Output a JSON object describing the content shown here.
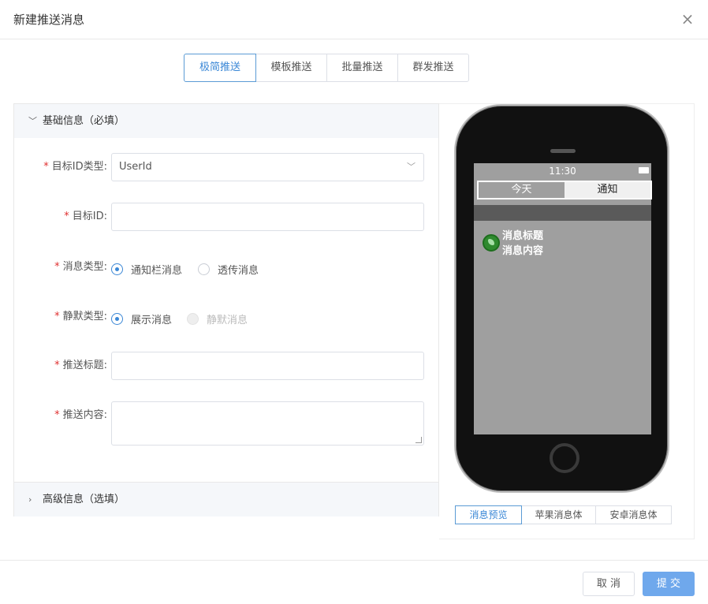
{
  "dialog": {
    "title": "新建推送消息",
    "close_icon": "×"
  },
  "tabs": [
    {
      "label": "极简推送",
      "active": true
    },
    {
      "label": "模板推送",
      "active": false
    },
    {
      "label": "批量推送",
      "active": false
    },
    {
      "label": "群发推送",
      "active": false
    }
  ],
  "form": {
    "basic_section": "基础信息（必填）",
    "advanced_section": "高级信息（选填）",
    "target_type": {
      "label": "目标ID类型:",
      "value": "UserId"
    },
    "target_id": {
      "label": "目标ID:",
      "value": ""
    },
    "message_type": {
      "label": "消息类型:",
      "options": [
        {
          "label": "通知栏消息",
          "selected": true
        },
        {
          "label": "透传消息",
          "selected": false
        }
      ]
    },
    "silent_type": {
      "label": "静默类型:",
      "options": [
        {
          "label": "展示消息",
          "selected": true
        },
        {
          "label": "静默消息",
          "selected": false,
          "disabled": true
        }
      ]
    },
    "push_title": {
      "label": "推送标题:",
      "value": ""
    },
    "push_content": {
      "label": "推送内容:",
      "value": ""
    }
  },
  "preview": {
    "time": "11:30",
    "segment_today": "今天",
    "segment_notify": "通知",
    "msg_title": "消息标题",
    "msg_body": "消息内容",
    "tabs": [
      {
        "label": "消息预览",
        "active": true
      },
      {
        "label": "苹果消息体",
        "active": false
      },
      {
        "label": "安卓消息体",
        "active": false
      }
    ]
  },
  "footer": {
    "cancel_label": "取 消",
    "submit_label": "提 交"
  },
  "colors": {
    "accent": "#3a87d6",
    "submit_bg": "#6fa8ec",
    "required": "#e03030"
  }
}
